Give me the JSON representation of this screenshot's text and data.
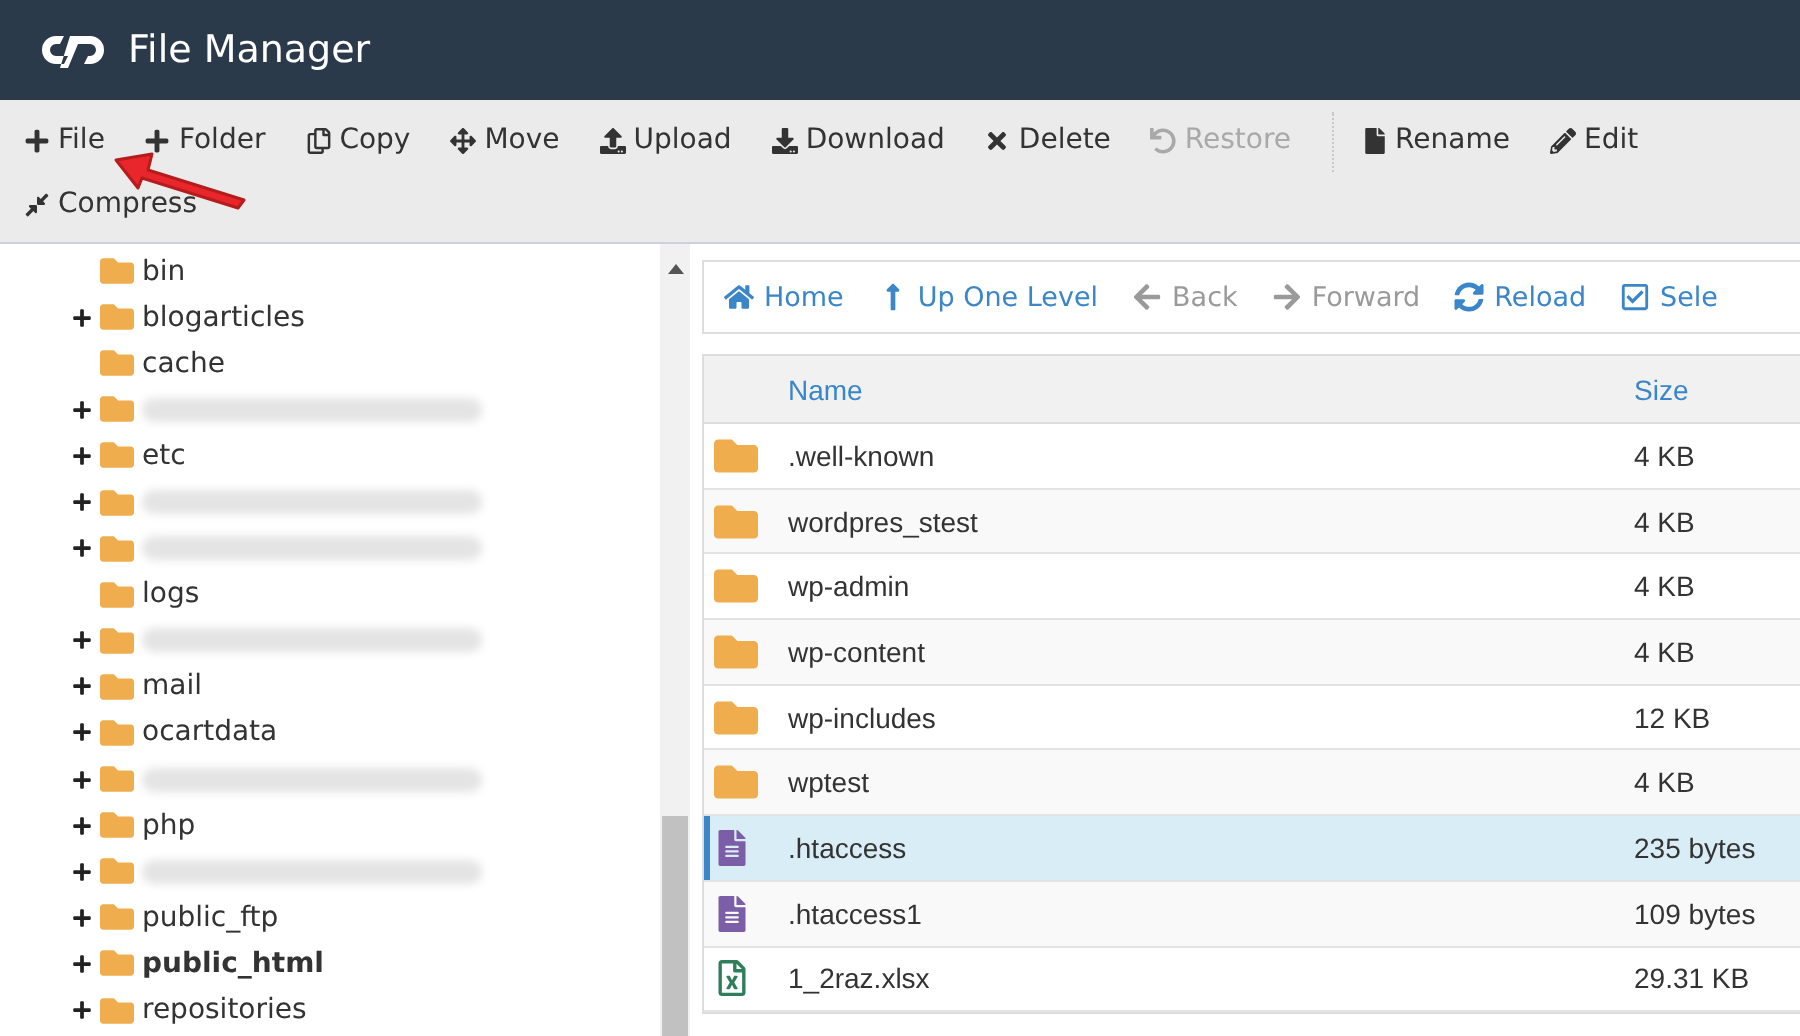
{
  "window": {
    "title": "File Manager"
  },
  "toolbar": [
    {
      "kind": "button",
      "label": "File",
      "disabled": false
    },
    {
      "kind": "button",
      "label": "Folder",
      "disabled": false
    },
    {
      "kind": "button",
      "label": "Copy",
      "disabled": false
    },
    {
      "kind": "button",
      "label": "Move",
      "disabled": false
    },
    {
      "kind": "button",
      "label": "Upload",
      "disabled": false
    },
    {
      "kind": "button",
      "label": "Download",
      "disabled": false
    },
    {
      "kind": "button",
      "label": "Delete",
      "disabled": false
    },
    {
      "kind": "button",
      "label": "Restore",
      "disabled": true
    },
    {
      "kind": "divider"
    },
    {
      "kind": "button",
      "label": "Rename",
      "disabled": false
    },
    {
      "kind": "button",
      "label": "Edit",
      "disabled": false
    },
    {
      "kind": "button",
      "label": "Compress",
      "disabled": false
    }
  ],
  "tree": [
    {
      "kind": "folder",
      "label": "bin",
      "expandable": false,
      "selected": false
    },
    {
      "kind": "folder",
      "label": "blogarticles",
      "expandable": true,
      "selected": false
    },
    {
      "kind": "folder",
      "label": "cache",
      "expandable": false,
      "selected": false
    },
    {
      "kind": "redacted",
      "expandable": true
    },
    {
      "kind": "folder",
      "label": "etc",
      "expandable": true,
      "selected": false
    },
    {
      "kind": "redacted",
      "expandable": true
    },
    {
      "kind": "redacted",
      "expandable": true
    },
    {
      "kind": "folder",
      "label": "logs",
      "expandable": false,
      "selected": false
    },
    {
      "kind": "redacted",
      "expandable": true
    },
    {
      "kind": "folder",
      "label": "mail",
      "expandable": true,
      "selected": false
    },
    {
      "kind": "folder",
      "label": "ocartdata",
      "expandable": true,
      "selected": false
    },
    {
      "kind": "redacted",
      "expandable": true
    },
    {
      "kind": "folder",
      "label": "php",
      "expandable": true,
      "selected": false
    },
    {
      "kind": "redacted",
      "expandable": true
    },
    {
      "kind": "folder",
      "label": "public_ftp",
      "expandable": true,
      "selected": false
    },
    {
      "kind": "folder",
      "label": "public_html",
      "expandable": true,
      "selected": true
    },
    {
      "kind": "folder",
      "label": "repositories",
      "expandable": true,
      "selected": false
    }
  ],
  "navigation": [
    {
      "label": "Home",
      "disabled": false
    },
    {
      "label": "Up One Level",
      "disabled": false
    },
    {
      "label": "Back",
      "disabled": true
    },
    {
      "label": "Forward",
      "disabled": true
    },
    {
      "label": "Reload",
      "disabled": false
    },
    {
      "label": "Sele",
      "disabled": false
    }
  ],
  "table": {
    "columns": [
      "Name",
      "Size"
    ],
    "rows": [
      {
        "kind": "folder",
        "name": ".well-known",
        "size": "4 KB",
        "selected": false
      },
      {
        "kind": "folder",
        "name": "wordpres_stest",
        "size": "4 KB",
        "selected": false
      },
      {
        "kind": "folder",
        "name": "wp-admin",
        "size": "4 KB",
        "selected": false
      },
      {
        "kind": "folder",
        "name": "wp-content",
        "size": "4 KB",
        "selected": false
      },
      {
        "kind": "folder",
        "name": "wp-includes",
        "size": "12 KB",
        "selected": false
      },
      {
        "kind": "folder",
        "name": "wptest",
        "size": "4 KB",
        "selected": false
      },
      {
        "kind": "text",
        "name": ".htaccess",
        "size": "235 bytes",
        "selected": true
      },
      {
        "kind": "text",
        "name": ".htaccess1",
        "size": "109 bytes",
        "selected": false
      },
      {
        "kind": "spreadsheet",
        "name": "1_2raz.xlsx",
        "size": "29.31 KB",
        "selected": false
      }
    ]
  }
}
